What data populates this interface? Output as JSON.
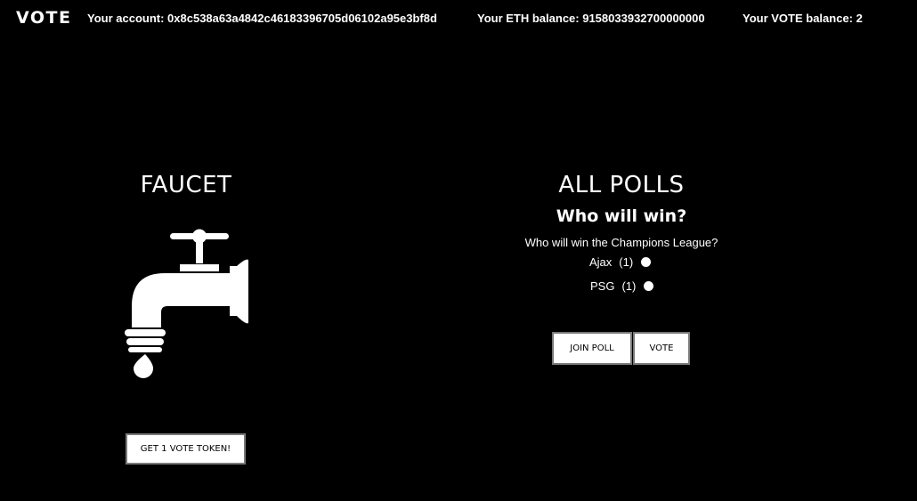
{
  "header": {
    "brand": "VOTE",
    "account_text": "Your account: 0x8c538a63a4842c46183396705d06102a95e3bf8d",
    "eth_balance_text": "Your ETH balance: 9158033932700000000",
    "vote_balance_text": "Your VOTE balance: 2"
  },
  "faucet": {
    "title": "FAUCET",
    "icon": "faucet-icon",
    "button_label": "GET 1 VOTE TOKEN!"
  },
  "polls": {
    "title": "ALL POLLS",
    "poll": {
      "name": "Who will win?",
      "question": "Who will win the Champions League?",
      "options": [
        {
          "label": "Ajax",
          "count": "(1)"
        },
        {
          "label": "PSG",
          "count": "(1)"
        }
      ]
    },
    "join_label": "JOIN POLL",
    "vote_label": "VOTE"
  },
  "colors": {
    "background": "#000000",
    "text": "#ffffff",
    "button_bg": "#ffffff",
    "button_text": "#000000"
  }
}
